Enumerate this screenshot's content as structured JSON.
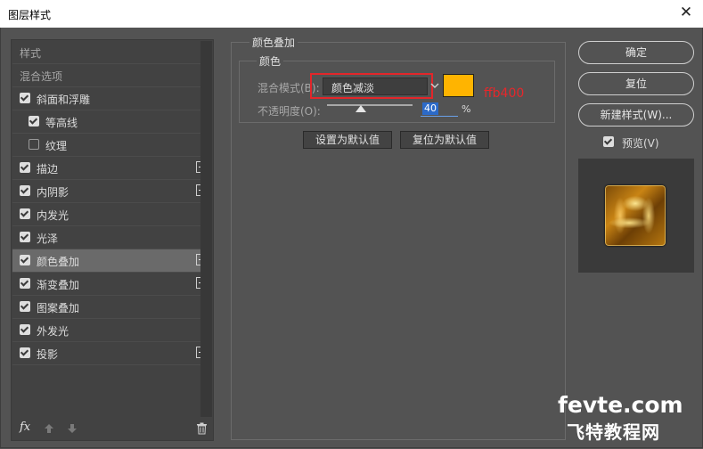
{
  "window": {
    "title": "图层样式",
    "close_glyph": "✕"
  },
  "styles_list": {
    "items": [
      {
        "label": "样式",
        "type": "header"
      },
      {
        "label": "混合选项",
        "type": "header"
      },
      {
        "label": "斜面和浮雕",
        "checked": true,
        "plus": false,
        "indent": false
      },
      {
        "label": "等高线",
        "checked": true,
        "plus": false,
        "indent": true
      },
      {
        "label": "纹理",
        "checked": false,
        "plus": false,
        "indent": true
      },
      {
        "label": "描边",
        "checked": true,
        "plus": true,
        "indent": false
      },
      {
        "label": "内阴影",
        "checked": true,
        "plus": true,
        "indent": false
      },
      {
        "label": "内发光",
        "checked": true,
        "plus": false,
        "indent": false
      },
      {
        "label": "光泽",
        "checked": true,
        "plus": false,
        "indent": false
      },
      {
        "label": "颜色叠加",
        "checked": true,
        "plus": true,
        "indent": false,
        "selected": true
      },
      {
        "label": "渐变叠加",
        "checked": true,
        "plus": true,
        "indent": false
      },
      {
        "label": "图案叠加",
        "checked": true,
        "plus": false,
        "indent": false
      },
      {
        "label": "外发光",
        "checked": true,
        "plus": false,
        "indent": false
      },
      {
        "label": "投影",
        "checked": true,
        "plus": true,
        "indent": false
      }
    ],
    "bottom": {
      "fx_label": "fx"
    }
  },
  "color_overlay": {
    "group_title": "颜色叠加",
    "subgroup_title": "颜色",
    "blend_mode_label": "混合模式(B):",
    "blend_mode_value": "颜色减淡",
    "color_hex": "#ffb400",
    "annotation": "ffb400",
    "opacity_label": "不透明度(O):",
    "opacity_value": "40",
    "opacity_unit": "%",
    "opacity_fraction": 0.4,
    "make_default_label": "设置为默认值",
    "reset_default_label": "复位为默认值"
  },
  "right_buttons": {
    "ok": "确定",
    "reset": "复位",
    "new_style": "新建样式(W)...",
    "preview_label": "预览(V)",
    "preview_checked": true
  },
  "watermark": {
    "line1": "fevte.com",
    "line2": "飞特教程网"
  }
}
